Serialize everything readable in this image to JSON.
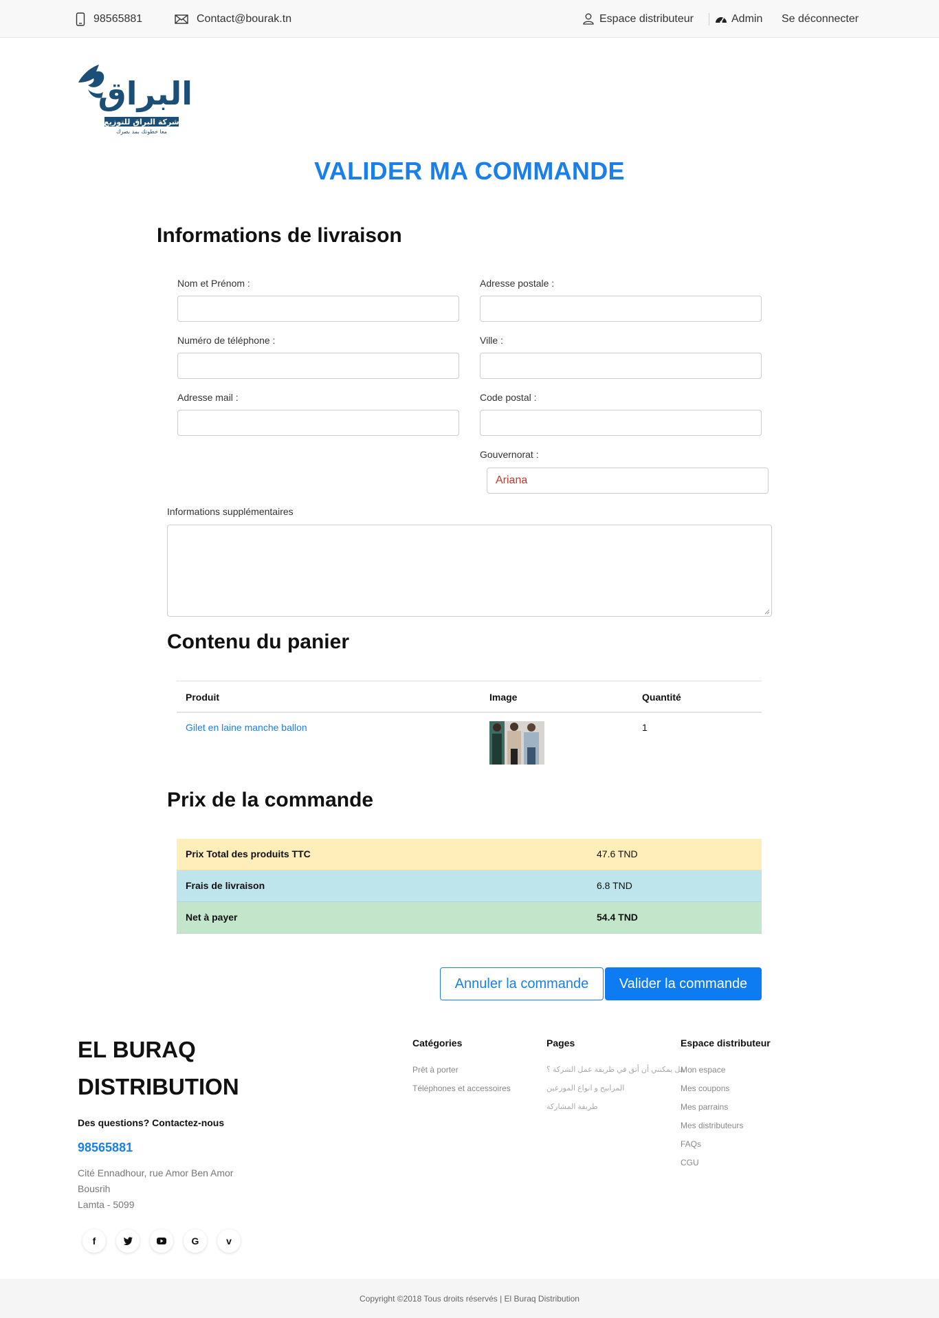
{
  "topbar": {
    "phone": "98565881",
    "email": "Contact@bourak.tn",
    "distributor_space": "Espace distributeur",
    "admin": "Admin",
    "logout": "Se déconnecter"
  },
  "logo": {
    "arabic_main": "البراق",
    "arabic_sub": "شركة البراق للتوزيع",
    "arabic_tagline": "معا خطوتك بمد بصرك"
  },
  "page_title": "VALIDER MA COMMANDE",
  "delivery": {
    "heading": "Informations de livraison",
    "name_label": "Nom et Prénom :",
    "address_label": "Adresse postale :",
    "phone_label": "Numéro de téléphone :",
    "city_label": "Ville :",
    "email_label": "Adresse mail :",
    "zip_label": "Code postal :",
    "governorate_label": "Gouvernorat :",
    "governorate_value": "Ariana",
    "extra_label": "Informations supplémentaires"
  },
  "cart": {
    "heading": "Contenu du panier",
    "columns": [
      "Produit",
      "Image",
      "Quantité"
    ],
    "rows": [
      {
        "product": "Gilet en laine manche ballon",
        "quantity": "1"
      }
    ]
  },
  "pricing": {
    "heading": "Prix de la commande",
    "rows": [
      {
        "label": "Prix Total des produits TTC",
        "value": "47.6 TND"
      },
      {
        "label": "Frais de livraison",
        "value": "6.8 TND"
      },
      {
        "label": "Net à payer",
        "value": "54.4 TND"
      }
    ]
  },
  "buttons": {
    "cancel": "Annuler la commande",
    "validate": "Valider la commande"
  },
  "footer": {
    "brand_line1": "EL BURAQ",
    "brand_line2": "DISTRIBUTION",
    "questions": "Des questions? Contactez-nous",
    "phone": "98565881",
    "address_line1": "Cité Ennadhour, rue Amor Ben Amor",
    "address_line2": "Bousrih",
    "address_line3": "Lamta - 5099",
    "social": [
      "f",
      "t",
      "▶",
      "G",
      "v"
    ],
    "categories": {
      "title": "Catégories",
      "links": [
        "Prêt à porter",
        "Téléphones et accessoires"
      ]
    },
    "pages": {
      "title": "Pages",
      "links": [
        "هل يمكنني أن أتق في طريقة عمل الشركة ؟",
        "المرابيح و انواع الموزعين",
        "طريقة المشاركة"
      ]
    },
    "distributor": {
      "title": "Espace distributeur",
      "links": [
        "Mon espace",
        "Mes coupons",
        "Mes parrains",
        "Mes distributeurs",
        "FAQs",
        "CGU"
      ]
    },
    "copyright": "Copyright ©2018 Tous droits réservés | El Buraq Distribution"
  }
}
